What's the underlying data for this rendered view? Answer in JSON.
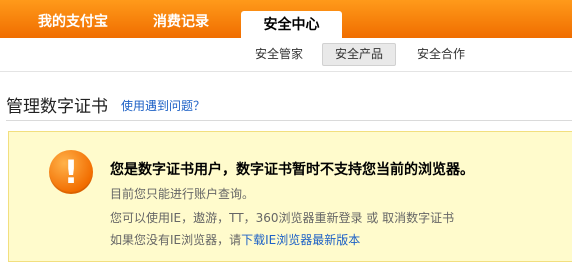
{
  "nav": {
    "tabs": [
      {
        "label": "我的支付宝"
      },
      {
        "label": "消费记录"
      },
      {
        "label": "安全中心",
        "active": true
      }
    ],
    "subtabs": [
      {
        "label": "安全管家"
      },
      {
        "label": "安全产品",
        "active": true
      },
      {
        "label": "安全合作"
      }
    ]
  },
  "page": {
    "title": "管理数字证书",
    "help_link": "使用遇到问题？"
  },
  "alert": {
    "icon": "exclamation-icon",
    "icon_glyph": "!",
    "headline": "您是数字证书用户，数字证书暂时不支持您当前的浏览器。",
    "line2": "目前您只能进行账户查询。",
    "line3_prefix": "您可以使用IE，遨游，TT，360浏览器重新登录 或 取消数字证书",
    "line4_prefix": "如果您没有IE浏览器，请",
    "line4_link": "下载IE浏览器最新版本"
  },
  "colors": {
    "topbar": "#f58200",
    "link": "#1d61c6",
    "alert_bg": "#fffbcc",
    "alert_border": "#f2df7f"
  }
}
